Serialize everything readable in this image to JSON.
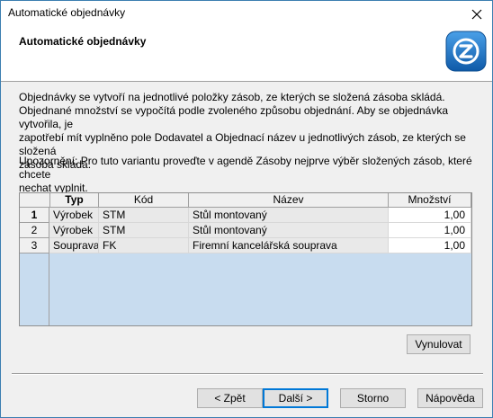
{
  "window": {
    "title": "Automatické objednávky"
  },
  "header": {
    "title": "Automatické objednávky"
  },
  "info": {
    "line1": "Objednávky se vytvoří na jednotlivé položky zásob, ze kterých se složená zásoba skládá.",
    "line2": "Objednané množství se vypočítá podle zvoleného způsobu objednání. Aby se objednávka vytvořila, je",
    "line3": "zapotřebí mít vyplněno pole Dodavatel a Objednací název u jednotlivých zásob, ze kterých se složená",
    "line4": "zásoba skládá.",
    "warn1": "Upozornění: Pro tuto variantu proveďte v agendě Zásoby nejprve výběr složených zásob, které chcete",
    "warn2": "nechat vyplnit."
  },
  "table": {
    "columns": [
      "Typ",
      "Kód",
      "Název",
      "Množství"
    ],
    "rows": [
      {
        "n": "1",
        "typ": "Výrobek",
        "kod": "STM",
        "nazev": "Stůl montovaný",
        "mnozstvi": "1,00"
      },
      {
        "n": "2",
        "typ": "Výrobek",
        "kod": "STM",
        "nazev": "Stůl montovaný",
        "mnozstvi": "1,00"
      },
      {
        "n": "3",
        "typ": "Souprava",
        "kod": "FK",
        "nazev": "Firemní kancelářská souprava",
        "mnozstvi": "1,00"
      }
    ]
  },
  "buttons": {
    "reset": "Vynulovat",
    "back": "< Zpět",
    "next": "Další >",
    "cancel": "Storno",
    "help": "Nápověda"
  },
  "colors": {
    "accent": "#0078d7",
    "grid_bg": "#c8dcef",
    "logo": "#1f6fbf"
  }
}
